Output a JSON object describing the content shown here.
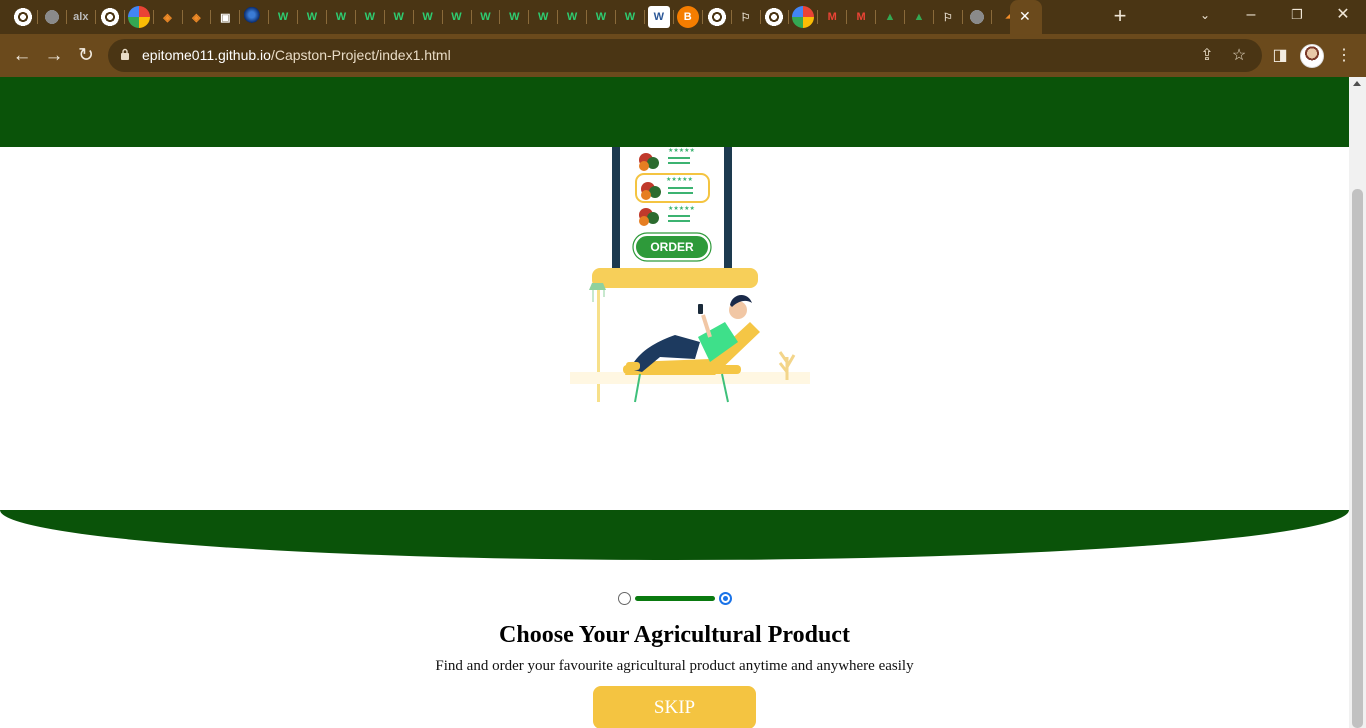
{
  "browser": {
    "tabs": [
      {
        "icon": "chrome-icon"
      },
      {
        "icon": "globe-icon"
      },
      {
        "icon": "alx-icon",
        "label": "alx"
      },
      {
        "icon": "chrome-icon"
      },
      {
        "icon": "google-icon"
      },
      {
        "icon": "diamond-icon"
      },
      {
        "icon": "diamond-icon"
      },
      {
        "icon": "robot-icon"
      },
      {
        "icon": "sphere-icon"
      },
      {
        "icon": "w-icon",
        "label": "W"
      },
      {
        "icon": "w-icon",
        "label": "W"
      },
      {
        "icon": "w-icon",
        "label": "W"
      },
      {
        "icon": "w-icon",
        "label": "W"
      },
      {
        "icon": "w-icon",
        "label": "W"
      },
      {
        "icon": "w-icon",
        "label": "W"
      },
      {
        "icon": "w-icon",
        "label": "W"
      },
      {
        "icon": "w-icon",
        "label": "W"
      },
      {
        "icon": "w-icon",
        "label": "W"
      },
      {
        "icon": "w-icon",
        "label": "W"
      },
      {
        "icon": "w-icon",
        "label": "W"
      },
      {
        "icon": "w-icon",
        "label": "W"
      },
      {
        "icon": "w-icon",
        "label": "W"
      },
      {
        "icon": "word-icon",
        "label": "W"
      },
      {
        "icon": "blogger-icon"
      },
      {
        "icon": "chrome-icon"
      },
      {
        "icon": "flag-icon"
      },
      {
        "icon": "chrome-icon"
      },
      {
        "icon": "google-icon"
      },
      {
        "icon": "gmail-icon"
      },
      {
        "icon": "gmail-icon"
      },
      {
        "icon": "drive-icon"
      },
      {
        "icon": "drive-icon"
      },
      {
        "icon": "flag-icon"
      },
      {
        "icon": "globe-icon"
      },
      {
        "icon": "triangle-icon"
      }
    ],
    "active_tab": {
      "icon": "close-icon"
    },
    "url_host": "epitome011.github.io",
    "url_path": "/Capston-Project/index1.html"
  },
  "colors": {
    "brand_green": "#0a5309",
    "accent_yellow": "#f4c441",
    "tabstrip": "#4a3514",
    "toolbar": "#6b4a1c"
  },
  "illustration": {
    "order_label": "ORDER"
  },
  "onboarding": {
    "slide_count": 2,
    "active_slide": 2,
    "title": "Choose Your Agricultural Product",
    "subtitle": "Find and order your favourite agricultural product anytime and anywhere easily",
    "skip_label": "SKIP"
  }
}
